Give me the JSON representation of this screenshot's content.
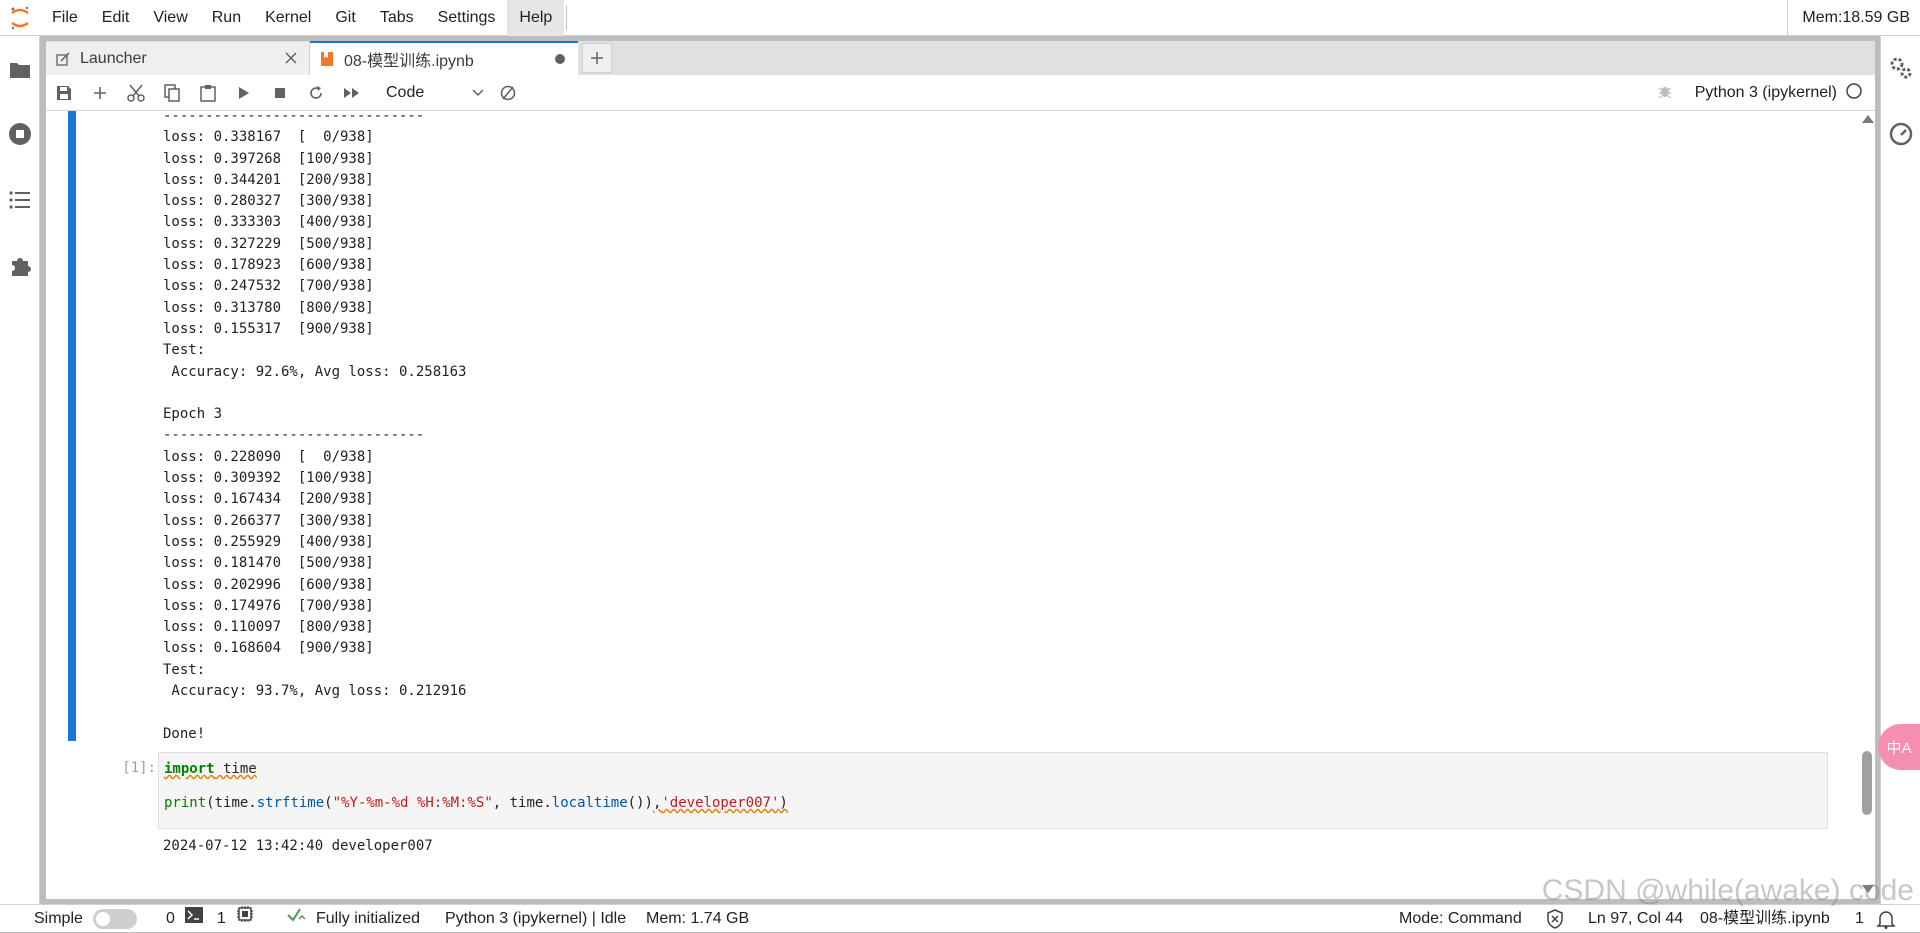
{
  "menubar": {
    "items": [
      "File",
      "Edit",
      "View",
      "Run",
      "Kernel",
      "Git",
      "Tabs",
      "Settings",
      "Help"
    ],
    "memory": "Mem:18.59 GB"
  },
  "tabs": [
    {
      "label": "Launcher"
    },
    {
      "label": "08-模型训练.ipynb"
    }
  ],
  "toolbar": {
    "cell_type": "Code",
    "kernel_name": "Python 3 (ipykernel)"
  },
  "output_lines": [
    "-------------------------------",
    "loss: 0.338167  [  0/938]",
    "loss: 0.397268  [100/938]",
    "loss: 0.344201  [200/938]",
    "loss: 0.280327  [300/938]",
    "loss: 0.333303  [400/938]",
    "loss: 0.327229  [500/938]",
    "loss: 0.178923  [600/938]",
    "loss: 0.247532  [700/938]",
    "loss: 0.313780  [800/938]",
    "loss: 0.155317  [900/938]",
    "Test:",
    " Accuracy: 92.6%, Avg loss: 0.258163",
    "",
    "Epoch 3",
    "-------------------------------",
    "loss: 0.228090  [  0/938]",
    "loss: 0.309392  [100/938]",
    "loss: 0.167434  [200/938]",
    "loss: 0.266377  [300/938]",
    "loss: 0.255929  [400/938]",
    "loss: 0.181470  [500/938]",
    "loss: 0.202996  [600/938]",
    "loss: 0.174976  [700/938]",
    "loss: 0.110097  [800/938]",
    "loss: 0.168604  [900/938]",
    "Test:",
    " Accuracy: 93.7%, Avg loss: 0.212916",
    "",
    "Done!"
  ],
  "cell2": {
    "prompt": "[1]:",
    "code": {
      "import_kw": "import",
      "import_mod": " time",
      "print_fn": "print",
      "p1": "(time.",
      "strftime": "strftime",
      "p2": "(",
      "fmt": "\"%Y-%m-%d %H:%M:%S\"",
      "p3": ", time.",
      "localtime": "localtime",
      "p4": "())",
      "comma": ",",
      "dev": "'developer007'",
      "p5": ")"
    },
    "output": "2024-07-12 13:42:40 developer007"
  },
  "statusbar": {
    "simple_label": "Simple",
    "terminals_count": "0",
    "kernels_count": "1",
    "init_status": "Fully initialized",
    "kernel_status": "Python 3 (ipykernel) | Idle",
    "mem": "Mem: 1.74 GB",
    "mode": "Mode: Command",
    "position": "Ln 97, Col 44",
    "filename": "08-模型训练.ipynb",
    "notif_count": "1"
  },
  "watermark": "CSDN @while(awake) code",
  "translate_label": "中A",
  "colors": {
    "accent": "#1976d2",
    "orange": "#f37726"
  },
  "icons": [
    "jupyter-logo-icon",
    "folder-icon",
    "stop-circle-icon",
    "toc-icon",
    "extension-icon",
    "gears-icon",
    "gauge-icon"
  ]
}
